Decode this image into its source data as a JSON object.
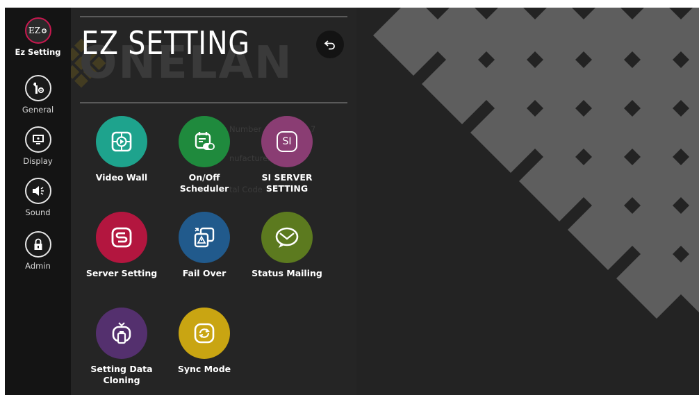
{
  "sidebar": {
    "items": [
      {
        "label": "Ez Setting",
        "icon": "ez-setting-icon",
        "glyph": "EZ",
        "active": true
      },
      {
        "label": "General",
        "icon": "wrench-gear-icon",
        "active": false
      },
      {
        "label": "Display",
        "icon": "display-icon",
        "active": false
      },
      {
        "label": "Sound",
        "icon": "speaker-icon",
        "active": false
      },
      {
        "label": "Admin",
        "icon": "lock-icon",
        "active": false
      }
    ]
  },
  "panel": {
    "title": "EZ SETTING",
    "watermark": "ONELAN",
    "ghost_text": [
      "Number",
      "7",
      "nufacturer",
      "tal Code"
    ]
  },
  "tiles": [
    {
      "label": "Video Wall",
      "icon": "video-wall-icon",
      "color": "#1ea38d"
    },
    {
      "label": "On/Off Scheduler",
      "icon": "scheduler-icon",
      "color": "#1f8a3d"
    },
    {
      "label": "SI SERVER SETTING",
      "icon": "si-server-icon",
      "color": "#8a3d73",
      "glyph": "SI"
    },
    {
      "label": "Server Setting",
      "icon": "server-icon",
      "color": "#b3163f"
    },
    {
      "label": "Fail Over",
      "icon": "fail-over-icon",
      "color": "#215a8c"
    },
    {
      "label": "Status Mailing",
      "icon": "mail-icon",
      "color": "#5c7a1f"
    },
    {
      "label": "Setting Data Cloning",
      "icon": "cloning-icon",
      "color": "#54306e"
    },
    {
      "label": "Sync Mode",
      "icon": "sync-icon",
      "color": "#c9a512"
    }
  ],
  "colors": {
    "active_ring": "#c8184f",
    "background": "#1c1c1c",
    "panel": "#252525",
    "diamond": "#5e5e5e"
  }
}
